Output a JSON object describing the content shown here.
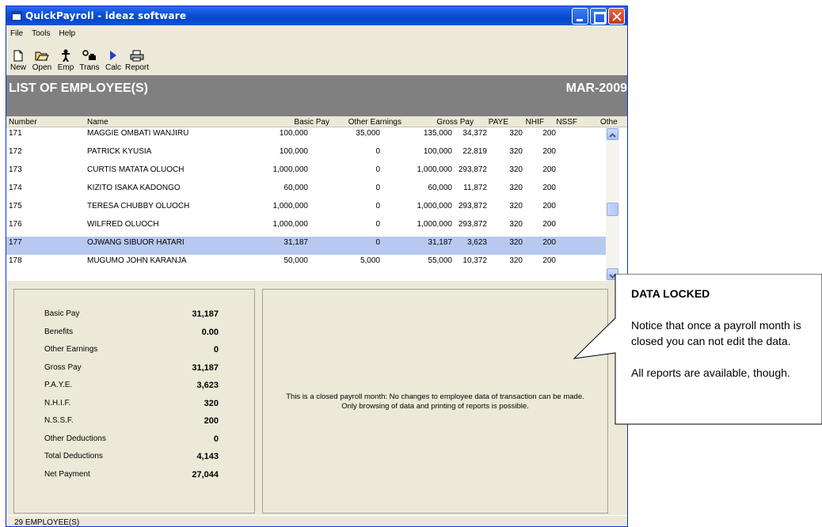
{
  "window": {
    "title": "QuickPayroll - ideaz software"
  },
  "menu": [
    "File",
    "Tools",
    "Help"
  ],
  "toolbar": [
    "New",
    "Open",
    "Emp",
    "Trans",
    "Calc",
    "Report"
  ],
  "header": {
    "title": "LIST OF EMPLOYEE(S)",
    "period": "MAR-2009"
  },
  "columns": [
    "Number",
    "Name",
    "Basic Pay",
    "Other Earnings",
    "Gross Pay",
    "PAYE",
    "NHIF",
    "NSSF",
    "Othe"
  ],
  "rows": [
    [
      "171",
      "MAGGIE OMBATI WANJIRU",
      "100,000",
      "35,000",
      "135,000",
      "34,372",
      "320",
      "200"
    ],
    [
      "172",
      "PATRICK KYUSIA",
      "100,000",
      "0",
      "100,000",
      "22,819",
      "320",
      "200"
    ],
    [
      "173",
      "CURTIS MATATA OLUOCH",
      "1,000,000",
      "0",
      "1,000,000",
      "293,872",
      "320",
      "200"
    ],
    [
      "174",
      "KIZITO ISAKA KADONGO",
      "60,000",
      "0",
      "60,000",
      "11,872",
      "320",
      "200"
    ],
    [
      "175",
      "TERESA CHUBBY OLUOCH",
      "1,000,000",
      "0",
      "1,000,000",
      "293,872",
      "320",
      "200"
    ],
    [
      "176",
      "WILFRED OLUOCH",
      "1,000,000",
      "0",
      "1,000,000",
      "293,872",
      "320",
      "200"
    ],
    [
      "177",
      "OJWANG SIBUOR HATARI",
      "31,187",
      "0",
      "31,187",
      "3,623",
      "320",
      "200"
    ],
    [
      "178",
      "MUGUMO JOHN KARANJA",
      "50,000",
      "5,000",
      "55,000",
      "10,372",
      "320",
      "200"
    ]
  ],
  "selected_row_index": 6,
  "summary": [
    {
      "label": "Basic Pay",
      "value": "31,187"
    },
    {
      "label": "Benefits",
      "value": "0.00"
    },
    {
      "label": "Other Earnings",
      "value": "0"
    },
    {
      "label": "Gross Pay",
      "value": "31,187"
    },
    {
      "label": "P.A.Y.E.",
      "value": "3,623"
    },
    {
      "label": "N.H.I.F.",
      "value": "320"
    },
    {
      "label": "N.S.S.F.",
      "value": "200"
    },
    {
      "label": "Other Deductions",
      "value": "0"
    },
    {
      "label": "Total Deductions",
      "value": "4,143"
    },
    {
      "label": "Net Payment",
      "value": "27,044"
    }
  ],
  "message": {
    "line1": "This is a closed payroll month: No changes to employee data of transaction can be made.",
    "line2": "Only browsing of data and printing of reports is possible."
  },
  "status": "29 EMPLOYEE(S)",
  "callout": {
    "title": "DATA LOCKED",
    "p1": "Notice that once a payroll month is closed you can not edit the data.",
    "p2": "All reports are available, though."
  },
  "colors": {
    "selection": "#b8c9ef",
    "header_bg": "#808080",
    "title_bar": "#0a4fd6"
  }
}
